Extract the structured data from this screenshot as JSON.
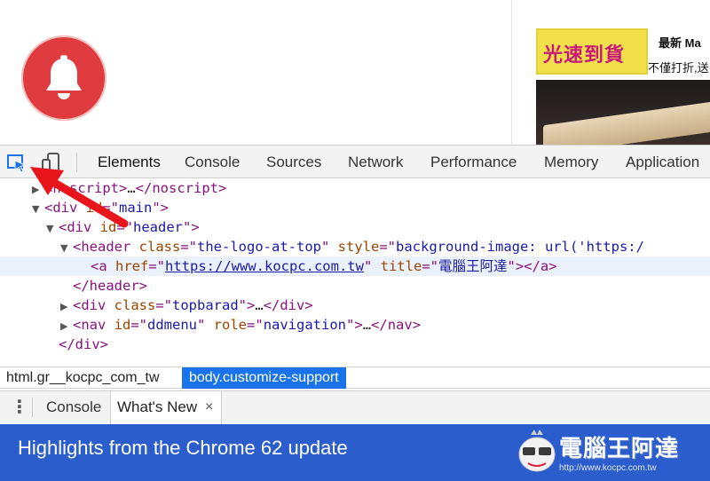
{
  "ad": {
    "logo_text": "光速到貨",
    "title": "最新 Ma",
    "subtitle": "不僅打折,送"
  },
  "toolbar": {
    "tabs": [
      "Elements",
      "Console",
      "Sources",
      "Network",
      "Performance",
      "Memory",
      "Application"
    ],
    "active_tab": "Elements"
  },
  "elements": {
    "lines": [
      {
        "tri": "▶",
        "parts": [
          [
            "tag",
            "<noscript>"
          ],
          [
            "plain",
            "…"
          ],
          [
            "tag",
            "</noscript>"
          ]
        ]
      },
      {
        "tri": "▼",
        "parts": [
          [
            "tag",
            "<div "
          ],
          [
            "attr",
            "id"
          ],
          [
            "tag",
            "=\""
          ],
          [
            "val",
            "main"
          ],
          [
            "tag",
            "\">"
          ]
        ]
      },
      {
        "tri": "▼",
        "parts": [
          [
            "tag",
            "<div "
          ],
          [
            "attr",
            "id"
          ],
          [
            "tag",
            "=\""
          ],
          [
            "val",
            "header"
          ],
          [
            "tag",
            "\">"
          ]
        ]
      },
      {
        "tri": "▼",
        "parts": [
          [
            "tag",
            "<header "
          ],
          [
            "attr",
            "class"
          ],
          [
            "tag",
            "=\""
          ],
          [
            "val",
            "the-logo-at-top"
          ],
          [
            "tag",
            "\" "
          ],
          [
            "attr",
            "style"
          ],
          [
            "tag",
            "=\""
          ],
          [
            "val",
            "background-image: url('https:/"
          ]
        ]
      },
      {
        "tri": "",
        "parts": [
          [
            "tag",
            "<a "
          ],
          [
            "attr",
            "href"
          ],
          [
            "tag",
            "=\""
          ],
          [
            "link",
            "https://www.kocpc.com.tw"
          ],
          [
            "tag",
            "\" "
          ],
          [
            "attr",
            "title"
          ],
          [
            "tag",
            "=\""
          ],
          [
            "val",
            "電腦王阿達"
          ],
          [
            "tag",
            "\"></a>"
          ]
        ]
      },
      {
        "tri": "",
        "parts": [
          [
            "tag",
            "</header>"
          ]
        ]
      },
      {
        "tri": "▶",
        "parts": [
          [
            "tag",
            "<div "
          ],
          [
            "attr",
            "class"
          ],
          [
            "tag",
            "=\""
          ],
          [
            "val",
            "topbarad"
          ],
          [
            "tag",
            "\">"
          ],
          [
            "plain",
            "…"
          ],
          [
            "tag",
            "</div>"
          ]
        ]
      },
      {
        "tri": "▶",
        "parts": [
          [
            "tag",
            "<nav "
          ],
          [
            "attr",
            "id"
          ],
          [
            "tag",
            "=\""
          ],
          [
            "val",
            "ddmenu"
          ],
          [
            "tag",
            "\" "
          ],
          [
            "attr",
            "role"
          ],
          [
            "tag",
            "=\""
          ],
          [
            "val",
            "navigation"
          ],
          [
            "tag",
            "\">"
          ],
          [
            "plain",
            "…"
          ],
          [
            "tag",
            "</nav>"
          ]
        ]
      },
      {
        "tri": "",
        "parts": [
          [
            "tag",
            "</div>"
          ]
        ]
      }
    ]
  },
  "breadcrumb": {
    "items": [
      "html.gr__kocpc_com_tw",
      "body.customize-support"
    ]
  },
  "drawer": {
    "menu_icon": "⋮",
    "console_label": "Console",
    "whats_new_label": "What's New",
    "close_icon": "×",
    "highlights_title": "Highlights from the Chrome 62 update"
  },
  "watermark": {
    "title": "電腦王阿達",
    "url": "http://www.kocpc.com.tw"
  },
  "colors": {
    "accent_blue": "#1a73e8",
    "highlights_bg": "#2b5dcc",
    "bell_red": "#e03b3f",
    "arrow_red": "#e8151b"
  }
}
